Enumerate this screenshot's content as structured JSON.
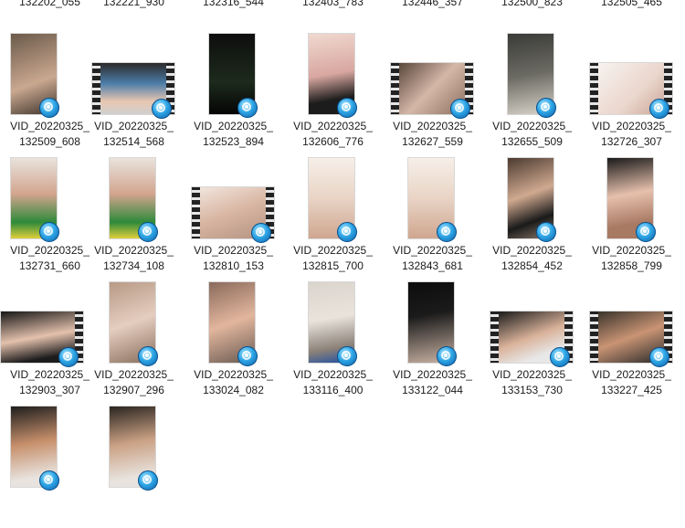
{
  "files": [
    {
      "line1": "",
      "line2": "132202_055"
    },
    {
      "line1": "",
      "line2": "132221_930"
    },
    {
      "line1": "",
      "line2": "132316_544"
    },
    {
      "line1": "",
      "line2": "132403_783"
    },
    {
      "line1": "",
      "line2": "132446_357"
    },
    {
      "line1": "",
      "line2": "132500_823"
    },
    {
      "line1": "",
      "line2": "132505_465"
    },
    {
      "line1": "VID_20220325_",
      "line2": "132509_608"
    },
    {
      "line1": "VID_20220325_",
      "line2": "132514_568"
    },
    {
      "line1": "VID_20220325_",
      "line2": "132523_894"
    },
    {
      "line1": "VID_20220325_",
      "line2": "132606_776"
    },
    {
      "line1": "VID_20220325_",
      "line2": "132627_559"
    },
    {
      "line1": "VID_20220325_",
      "line2": "132655_509"
    },
    {
      "line1": "VID_20220325_",
      "line2": "132726_307"
    },
    {
      "line1": "VID_20220325_",
      "line2": "132731_660"
    },
    {
      "line1": "VID_20220325_",
      "line2": "132734_108"
    },
    {
      "line1": "VID_20220325_",
      "line2": "132810_153"
    },
    {
      "line1": "VID_20220325_",
      "line2": "132815_700"
    },
    {
      "line1": "VID_20220325_",
      "line2": "132843_681"
    },
    {
      "line1": "VID_20220325_",
      "line2": "132854_452"
    },
    {
      "line1": "VID_20220325_",
      "line2": "132858_799"
    },
    {
      "line1": "VID_20220325_",
      "line2": "132903_307"
    },
    {
      "line1": "VID_20220325_",
      "line2": "132907_296"
    },
    {
      "line1": "VID_20220325_",
      "line2": "133024_082"
    },
    {
      "line1": "VID_20220325_",
      "line2": "133116_400"
    },
    {
      "line1": "VID_20220325_",
      "line2": "133122_044"
    },
    {
      "line1": "VID_20220325_",
      "line2": "133153_730"
    },
    {
      "line1": "VID_20220325_",
      "line2": "133227_425"
    }
  ]
}
